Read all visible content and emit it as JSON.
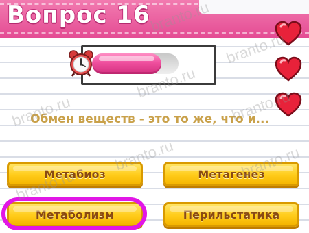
{
  "header": {
    "title": "Вопрос 16"
  },
  "timer": {
    "remaining": 0.8
  },
  "lives": {
    "count": 3,
    "icon": "heart-icon"
  },
  "question": {
    "text": "Обмен веществ - это то же, что и..."
  },
  "answers": [
    {
      "label": "Метабиоз"
    },
    {
      "label": "Метагенез"
    },
    {
      "label": "Метаболизм",
      "highlighted": true
    },
    {
      "label": "Перильстатика"
    }
  ],
  "watermark": {
    "text": "branto.ru"
  },
  "colors": {
    "header": "#e44b93",
    "answer": "#ffcc1a",
    "answer_text": "#8a4a12",
    "question_text": "#c9a14a",
    "highlight": "#e117e6"
  }
}
